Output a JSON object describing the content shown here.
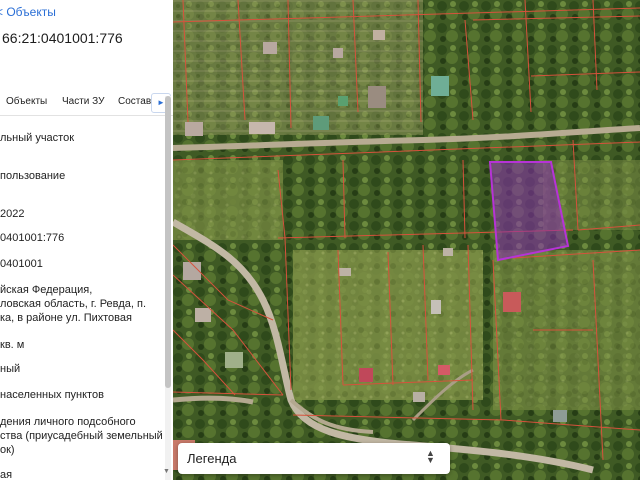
{
  "panel": {
    "back_link": "< Объекты",
    "title": "66:21:0401001:776",
    "tabs": [
      {
        "label": "Объекты"
      },
      {
        "label": "Части ЗУ"
      },
      {
        "label": "Состав"
      }
    ],
    "tab_next_icon": "chevron-right-icon",
    "attributes": [
      "льный участок",
      "пользование",
      "2022",
      "0401001:776",
      "0401001",
      "йская Федерация,\nловская область, г. Ревда, п.\nка, в районе ул. Пихтовая",
      "кв. м",
      "ный",
      "населенных пунктов",
      "дения личного подсобного\nства (приусадебный земельный\nок)",
      "ая"
    ]
  },
  "map": {
    "selected_parcel_color": "#b633d6",
    "boundary_color": "#d6523c"
  },
  "legend": {
    "label": "Легенда",
    "icon": "chevron-up-down-icon"
  },
  "colors": {
    "link": "#2b6fd6",
    "panel_bg": "#ffffff"
  }
}
